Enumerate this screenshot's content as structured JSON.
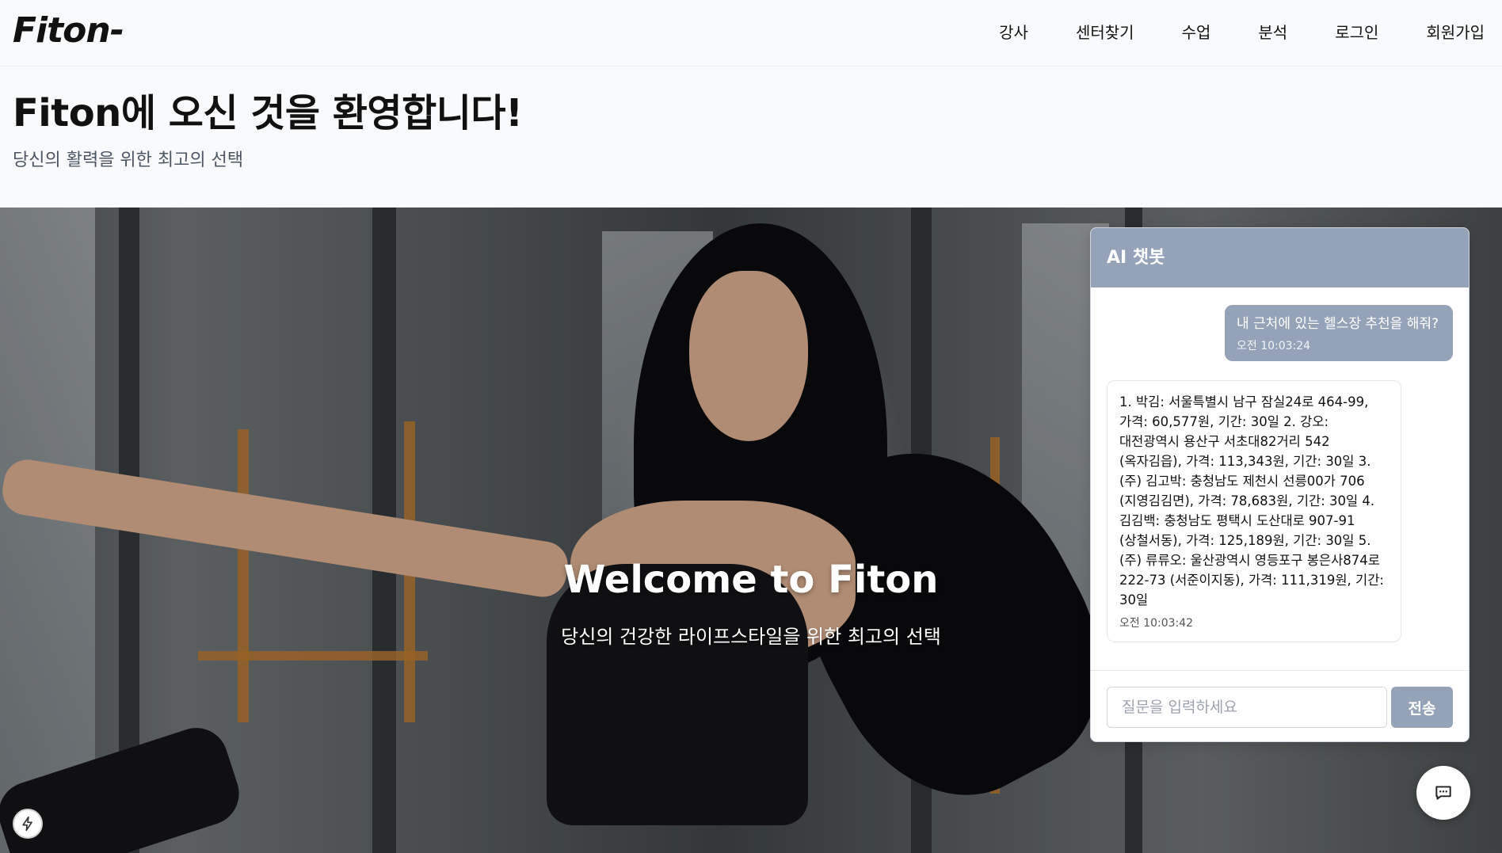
{
  "brand": {
    "logo": "Fiton-"
  },
  "nav": {
    "items": [
      "강사",
      "센터찾기",
      "수업",
      "분석",
      "로그인",
      "회원가입"
    ]
  },
  "intro": {
    "title": "Fiton에 오신 것을 환영합니다!",
    "subtitle": "당신의 활력을 위한 최고의 선택"
  },
  "hero": {
    "title": "Welcome to Fiton",
    "subtitle": "당신의 건강한 라이프스타일을 위한 최고의 선택"
  },
  "chat": {
    "title": "AI 챗봇",
    "messages": [
      {
        "role": "user",
        "text": "내 근처에 있는 헬스장 추천을 해줘?",
        "time": "오전 10:03:24"
      },
      {
        "role": "bot",
        "text": "1. 박김: 서울특별시 남구 잠실24로 464-99, 가격: 60,577원, 기간: 30일 2. 강오: 대전광역시 용산구 서초대82거리 542 (옥자김읍), 가격: 113,343원, 기간: 30일 3. (주) 김고박: 충청남도 제천시 선릉00가 706 (지영김김면), 가격: 78,683원, 기간: 30일 4. 김김백: 충청남도 평택시 도산대로 907-91 (상철서동), 가격: 125,189원, 기간: 30일 5. (주) 류류오: 울산광역시 영등포구 봉은사874로 222-73 (서준이지동), 가격: 111,319원, 기간: 30일",
        "time": "오전 10:03:42"
      }
    ],
    "input_placeholder": "질문을 입력하세요",
    "input_value": "",
    "send_label": "전송"
  },
  "icons": {
    "chat_fab": "chat-bubble-icon",
    "bolt": "lightning-icon"
  },
  "colors": {
    "accent": "#94a3b8",
    "page_bg": "#f8fafc",
    "text": "#111111"
  }
}
